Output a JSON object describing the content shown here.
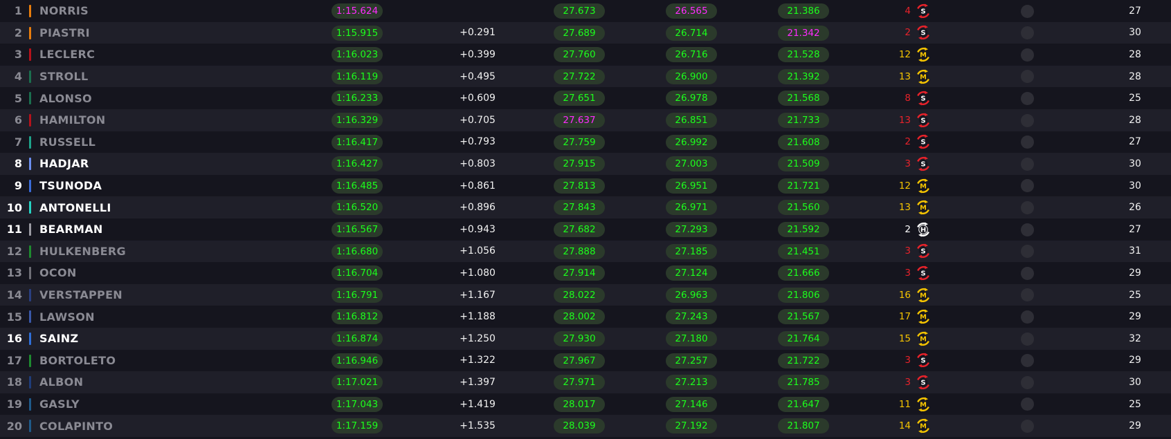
{
  "colors": {
    "background": "#15151e",
    "row_alt": "#1f1f29",
    "personal_best": "#1cff1c",
    "overall_best": "#ff2bff",
    "soft": "#e8222a",
    "medium": "#f5c400",
    "hard": "#ffffff"
  },
  "rows": [
    {
      "pos": "1",
      "driver": "NORRIS",
      "team_color": "#e87d0d",
      "highlight": false,
      "best": "1:15.624",
      "best_purple": true,
      "gap": "",
      "s1": "27.673",
      "s1_purple": false,
      "s2": "26.565",
      "s2_purple": true,
      "s3": "21.386",
      "s3_purple": false,
      "tyre_age": "4",
      "compound": "S",
      "laps": "27"
    },
    {
      "pos": "2",
      "driver": "PIASTRI",
      "team_color": "#e87d0d",
      "highlight": false,
      "best": "1:15.915",
      "best_purple": false,
      "gap": "+0.291",
      "s1": "27.689",
      "s1_purple": false,
      "s2": "26.714",
      "s2_purple": false,
      "s3": "21.342",
      "s3_purple": true,
      "tyre_age": "2",
      "compound": "S",
      "laps": "30"
    },
    {
      "pos": "3",
      "driver": "LECLERC",
      "team_color": "#b5121b",
      "highlight": false,
      "best": "1:16.023",
      "best_purple": false,
      "gap": "+0.399",
      "s1": "27.760",
      "s1_purple": false,
      "s2": "26.716",
      "s2_purple": false,
      "s3": "21.528",
      "s3_purple": false,
      "tyre_age": "12",
      "compound": "M",
      "laps": "28"
    },
    {
      "pos": "4",
      "driver": "STROLL",
      "team_color": "#1b6e4e",
      "highlight": false,
      "best": "1:16.119",
      "best_purple": false,
      "gap": "+0.495",
      "s1": "27.722",
      "s1_purple": false,
      "s2": "26.900",
      "s2_purple": false,
      "s3": "21.392",
      "s3_purple": false,
      "tyre_age": "13",
      "compound": "M",
      "laps": "28"
    },
    {
      "pos": "5",
      "driver": "ALONSO",
      "team_color": "#1b6e4e",
      "highlight": false,
      "best": "1:16.233",
      "best_purple": false,
      "gap": "+0.609",
      "s1": "27.651",
      "s1_purple": false,
      "s2": "26.978",
      "s2_purple": false,
      "s3": "21.568",
      "s3_purple": false,
      "tyre_age": "8",
      "compound": "S",
      "laps": "25"
    },
    {
      "pos": "6",
      "driver": "HAMILTON",
      "team_color": "#b5121b",
      "highlight": false,
      "best": "1:16.329",
      "best_purple": false,
      "gap": "+0.705",
      "s1": "27.637",
      "s1_purple": true,
      "s2": "26.851",
      "s2_purple": false,
      "s3": "21.733",
      "s3_purple": false,
      "tyre_age": "13",
      "compound": "S",
      "laps": "28"
    },
    {
      "pos": "7",
      "driver": "RUSSELL",
      "team_color": "#1fa38a",
      "highlight": false,
      "best": "1:16.417",
      "best_purple": false,
      "gap": "+0.793",
      "s1": "27.759",
      "s1_purple": false,
      "s2": "26.992",
      "s2_purple": false,
      "s3": "21.608",
      "s3_purple": false,
      "tyre_age": "2",
      "compound": "S",
      "laps": "27"
    },
    {
      "pos": "8",
      "driver": "HADJAR",
      "team_color": "#6c8ff0",
      "highlight": true,
      "best": "1:16.427",
      "best_purple": false,
      "gap": "+0.803",
      "s1": "27.915",
      "s1_purple": false,
      "s2": "27.003",
      "s2_purple": false,
      "s3": "21.509",
      "s3_purple": false,
      "tyre_age": "3",
      "compound": "S",
      "laps": "30"
    },
    {
      "pos": "9",
      "driver": "TSUNODA",
      "team_color": "#3a6bd8",
      "highlight": true,
      "best": "1:16.485",
      "best_purple": false,
      "gap": "+0.861",
      "s1": "27.813",
      "s1_purple": false,
      "s2": "26.951",
      "s2_purple": false,
      "s3": "21.721",
      "s3_purple": false,
      "tyre_age": "12",
      "compound": "M",
      "laps": "30"
    },
    {
      "pos": "10",
      "driver": "ANTONELLI",
      "team_color": "#27d3c3",
      "highlight": true,
      "best": "1:16.520",
      "best_purple": false,
      "gap": "+0.896",
      "s1": "27.843",
      "s1_purple": false,
      "s2": "26.971",
      "s2_purple": false,
      "s3": "21.560",
      "s3_purple": false,
      "tyre_age": "13",
      "compound": "M",
      "laps": "26"
    },
    {
      "pos": "11",
      "driver": "BEARMAN",
      "team_color": "#9b9ba3",
      "highlight": true,
      "best": "1:16.567",
      "best_purple": false,
      "gap": "+0.943",
      "s1": "27.682",
      "s1_purple": false,
      "s2": "27.293",
      "s2_purple": false,
      "s3": "21.592",
      "s3_purple": false,
      "tyre_age": "2",
      "compound": "H",
      "laps": "27"
    },
    {
      "pos": "12",
      "driver": "HULKENBERG",
      "team_color": "#1e8a2f",
      "highlight": false,
      "best": "1:16.680",
      "best_purple": false,
      "gap": "+1.056",
      "s1": "27.888",
      "s1_purple": false,
      "s2": "27.185",
      "s2_purple": false,
      "s3": "21.451",
      "s3_purple": false,
      "tyre_age": "3",
      "compound": "S",
      "laps": "31"
    },
    {
      "pos": "13",
      "driver": "OCON",
      "team_color": "#6e6e76",
      "highlight": false,
      "best": "1:16.704",
      "best_purple": false,
      "gap": "+1.080",
      "s1": "27.914",
      "s1_purple": false,
      "s2": "27.124",
      "s2_purple": false,
      "s3": "21.666",
      "s3_purple": false,
      "tyre_age": "3",
      "compound": "S",
      "laps": "29"
    },
    {
      "pos": "14",
      "driver": "VERSTAPPEN",
      "team_color": "#2a3f80",
      "highlight": false,
      "best": "1:16.791",
      "best_purple": false,
      "gap": "+1.167",
      "s1": "28.022",
      "s1_purple": false,
      "s2": "26.963",
      "s2_purple": false,
      "s3": "21.806",
      "s3_purple": false,
      "tyre_age": "16",
      "compound": "M",
      "laps": "25"
    },
    {
      "pos": "15",
      "driver": "LAWSON",
      "team_color": "#3a58a8",
      "highlight": false,
      "best": "1:16.812",
      "best_purple": false,
      "gap": "+1.188",
      "s1": "28.002",
      "s1_purple": false,
      "s2": "27.243",
      "s2_purple": false,
      "s3": "21.567",
      "s3_purple": false,
      "tyre_age": "17",
      "compound": "M",
      "laps": "29"
    },
    {
      "pos": "16",
      "driver": "SAINZ",
      "team_color": "#2f6fd8",
      "highlight": true,
      "best": "1:16.874",
      "best_purple": false,
      "gap": "+1.250",
      "s1": "27.930",
      "s1_purple": false,
      "s2": "27.180",
      "s2_purple": false,
      "s3": "21.764",
      "s3_purple": false,
      "tyre_age": "15",
      "compound": "M",
      "laps": "32"
    },
    {
      "pos": "17",
      "driver": "BORTOLETO",
      "team_color": "#1e8a2f",
      "highlight": false,
      "best": "1:16.946",
      "best_purple": false,
      "gap": "+1.322",
      "s1": "27.967",
      "s1_purple": false,
      "s2": "27.257",
      "s2_purple": false,
      "s3": "21.722",
      "s3_purple": false,
      "tyre_age": "3",
      "compound": "S",
      "laps": "29"
    },
    {
      "pos": "18",
      "driver": "ALBON",
      "team_color": "#1f3d7a",
      "highlight": false,
      "best": "1:17.021",
      "best_purple": false,
      "gap": "+1.397",
      "s1": "27.971",
      "s1_purple": false,
      "s2": "27.213",
      "s2_purple": false,
      "s3": "21.785",
      "s3_purple": false,
      "tyre_age": "3",
      "compound": "S",
      "laps": "30"
    },
    {
      "pos": "19",
      "driver": "GASLY",
      "team_color": "#1f5a8a",
      "highlight": false,
      "best": "1:17.043",
      "best_purple": false,
      "gap": "+1.419",
      "s1": "28.017",
      "s1_purple": false,
      "s2": "27.146",
      "s2_purple": false,
      "s3": "21.647",
      "s3_purple": false,
      "tyre_age": "11",
      "compound": "M",
      "laps": "25"
    },
    {
      "pos": "20",
      "driver": "COLAPINTO",
      "team_color": "#1f5a8a",
      "highlight": false,
      "best": "1:17.159",
      "best_purple": false,
      "gap": "+1.535",
      "s1": "28.039",
      "s1_purple": false,
      "s2": "27.192",
      "s2_purple": false,
      "s3": "21.807",
      "s3_purple": false,
      "tyre_age": "14",
      "compound": "M",
      "laps": "29"
    }
  ]
}
